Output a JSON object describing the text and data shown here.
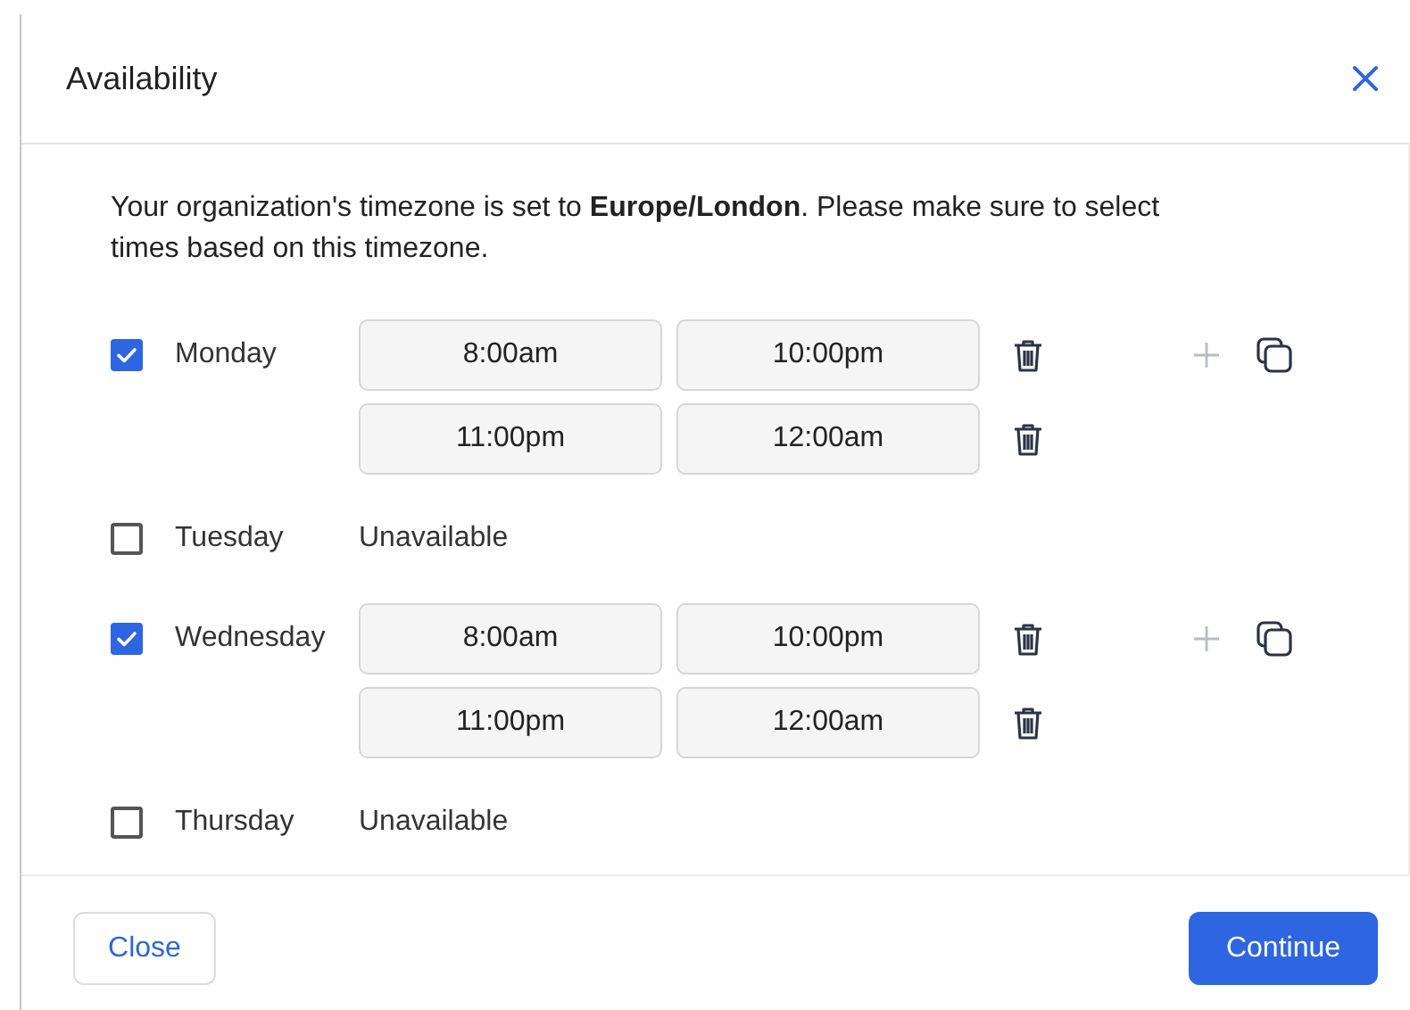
{
  "dialog": {
    "title": "Availability"
  },
  "notice": "Your organization's timezone is set to **Europe/London**. Please make sure to select times based on this timezone.",
  "days": [
    {
      "name": "Monday",
      "checked": true,
      "ranges": [
        {
          "start": "8:00am",
          "end": "10:00pm"
        },
        {
          "start": "11:00pm",
          "end": "12:00am"
        }
      ]
    },
    {
      "name": "Tuesday",
      "checked": false,
      "status": "Unavailable"
    },
    {
      "name": "Wednesday",
      "checked": true,
      "ranges": [
        {
          "start": "8:00am",
          "end": "10:00pm"
        },
        {
          "start": "11:00pm",
          "end": "12:00am"
        }
      ]
    },
    {
      "name": "Thursday",
      "checked": false,
      "status": "Unavailable"
    }
  ],
  "buttons": [
    {
      "label": "Close",
      "kind": "secondary"
    },
    {
      "label": "Continue",
      "kind": "primary"
    }
  ]
}
